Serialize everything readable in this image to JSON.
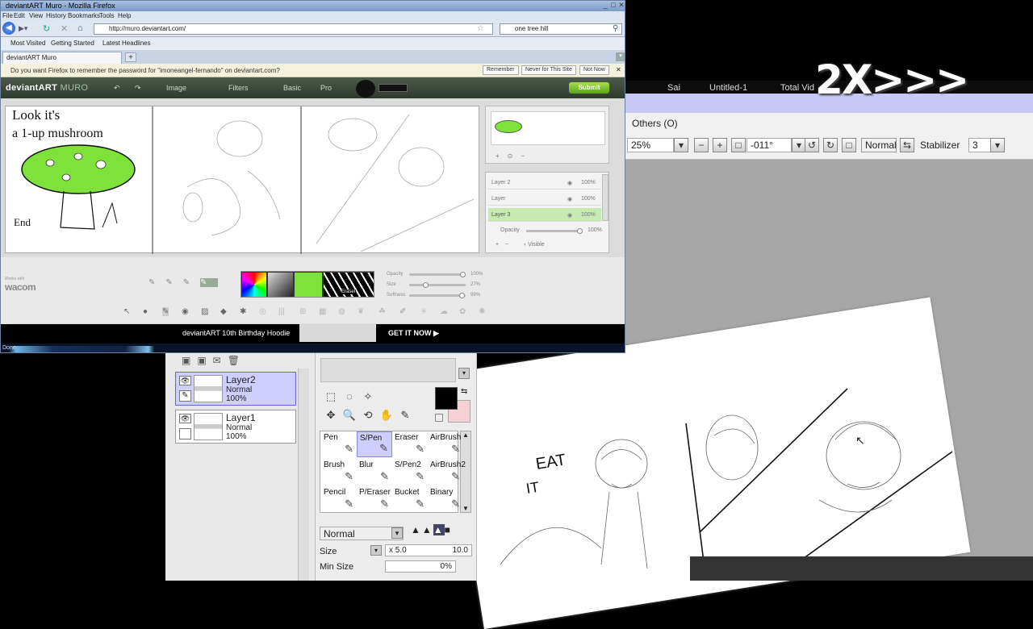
{
  "overlay": {
    "speed_label": "2X>>>"
  },
  "sai": {
    "tabs": [
      "Sai",
      "Untitled-1",
      "Total Vid"
    ],
    "menu_others": "Others (O)",
    "zoom": "25%",
    "angle": "-011°",
    "blend_mode_top": "Normal",
    "stabilizer_label": "Stabilizer",
    "stabilizer_value": "3",
    "layers": [
      {
        "name": "Layer2",
        "mode": "Normal",
        "opacity": "100%",
        "active": true
      },
      {
        "name": "Layer1",
        "mode": "Normal",
        "opacity": "100%",
        "active": false
      }
    ],
    "tools": [
      [
        "Pen",
        "S/Pen",
        "Eraser",
        "AirBrush"
      ],
      [
        "Brush",
        "Blur",
        "S/Pen2",
        "AirBrush2"
      ],
      [
        "Pencil",
        "P/Eraser",
        "Bucket",
        "Binary"
      ]
    ],
    "tool_bottom_labels": [
      "",
      "",
      "k",
      ""
    ],
    "selected_tool": "S/Pen",
    "brush_blend_mode": "Normal",
    "size_label": "Size",
    "size_multiplier": "x 5.0",
    "size_value": "10.0",
    "min_size_label": "Min Size",
    "min_size_value": "0%",
    "sketch_text": {
      "eat": "EAT",
      "it": "IT"
    },
    "primary_color": "#000000",
    "secondary_color": "#f5d0d4"
  },
  "firefox": {
    "window_title": "deviantART Muro - Mozilla Firefox",
    "menu": [
      "File",
      "Edit",
      "View",
      "History",
      "Bookmarks",
      "Tools",
      "Help"
    ],
    "url": "http://muro.deviantart.com/",
    "search_text": "one tree hill",
    "bookmarks": [
      "Most Visited",
      "Getting Started",
      "Latest Headlines"
    ],
    "tab_title": "deviantART Muro",
    "password_prompt": "Do you want Firefox to remember the password for \"imoneangel-fernando\" on deviantart.com?",
    "password_buttons": [
      "Remember",
      "Never for This Site",
      "Not Now"
    ],
    "status": "Done"
  },
  "muro": {
    "logo_main": "deviantART",
    "logo_sub": "MURO",
    "menus": [
      "Image",
      "Filters"
    ],
    "mode_basic": "Basic",
    "mode_pro": "Pro",
    "submit_label": "Submit",
    "canvas_text_1": "Look it's",
    "canvas_text_2": "a 1-up mushroom",
    "canvas_text_3": "End",
    "layers": [
      {
        "name": "Layer 2",
        "opacity": "100%"
      },
      {
        "name": "Layer",
        "opacity": "100%"
      },
      {
        "name": "Layer 3",
        "opacity": "100%",
        "active": true
      }
    ],
    "opacity_label": "Opacity",
    "opacity_value": "100%",
    "visible_label": "Visible",
    "sliders": [
      {
        "label": "Opacity",
        "value": "100%",
        "fraction": 1.0
      },
      {
        "label": "Size",
        "value": "27%",
        "fraction": 0.27
      },
      {
        "label": "Softness",
        "value": "99%",
        "fraction": 0.99
      }
    ],
    "eraser_label": "Eraser",
    "wacom_small": "Works with",
    "wacom_label": "wacom",
    "ad_text": "deviantART 10th Birthday Hoodie",
    "ad_cta": "GET IT NOW",
    "accent_green": "#7ee23a"
  }
}
